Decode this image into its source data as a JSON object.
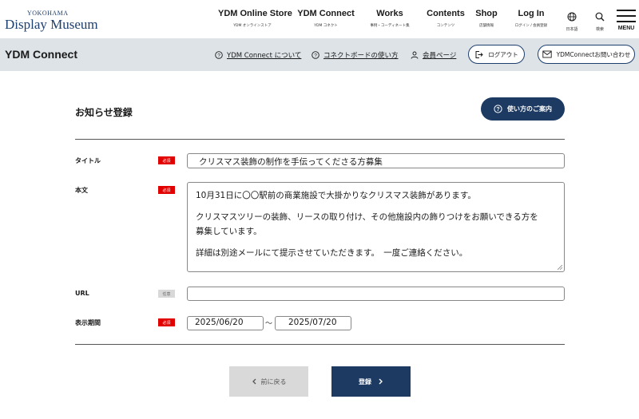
{
  "logo": {
    "small": "YOKOHAMA",
    "big": "Display Museum"
  },
  "nav": [
    {
      "main": "YDM Online Store",
      "sub": "YDM オンラインストア"
    },
    {
      "main": "YDM Connect",
      "sub": "YDM コネクト"
    },
    {
      "main": "Works",
      "sub": "事例・コーディネート集"
    },
    {
      "main": "Contents",
      "sub": "コンテンツ"
    },
    {
      "main": "Shop",
      "sub": "店舗情報"
    },
    {
      "main": "Log In",
      "sub": "ログイン / 会員登録"
    }
  ],
  "lang": {
    "sub": "日本語",
    "icon": "globe-icon"
  },
  "search": {
    "sub": "検索",
    "icon": "search-icon"
  },
  "menu": {
    "label": "MENU"
  },
  "subbar": {
    "title": "YDM Connect",
    "links": [
      {
        "label": "YDM Connect について",
        "icon": "help-circle-icon"
      },
      {
        "label": "コネクトボードの使い方",
        "icon": "help-circle-icon"
      },
      {
        "label": "会員ページ",
        "icon": "user-icon"
      }
    ],
    "logout": "ログアウト",
    "contact": "YDMConnectお問い合わせ"
  },
  "page": {
    "title": "お知らせ登録",
    "help_button": "使い方のご案内"
  },
  "form": {
    "required_badge": "必須",
    "optional_badge": "任意",
    "title_label": "タイトル",
    "title_value": "クリスマス装飾の制作を手伝ってくださる方募集",
    "body_label": "本文",
    "body_lines": [
      "10月31日に〇〇駅前の商業施設で大掛かりなクリスマス装飾があります。",
      "",
      "クリスマスツリーの装飾、リースの取り付け、その他施設内の飾りつけをお願いできる方を",
      "募集しています。",
      "",
      "詳細は別途メールにて提示させていただきます。　一度ご連絡ください。"
    ],
    "url_label": "URL",
    "url_value": "",
    "period_label": "表示期間",
    "period_start": "2025/06/20",
    "period_separator": "～",
    "period_end": "2025/07/20"
  },
  "buttons": {
    "back": "前に戻る",
    "submit": "登録"
  },
  "colors": {
    "navy": "#1d3a62",
    "required": "#e00000",
    "subbar_bg": "#dde3e7"
  }
}
